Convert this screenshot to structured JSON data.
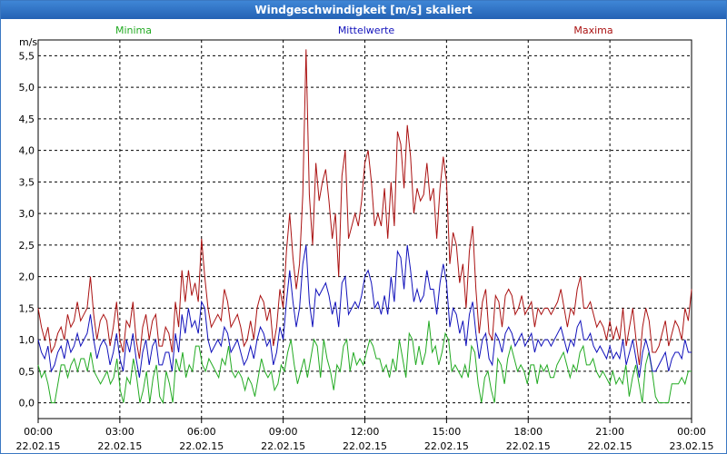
{
  "window": {
    "title": "Windgeschwindigkeit [m/s] skaliert"
  },
  "chart_data": {
    "type": "line",
    "ylabel": "m/s",
    "ylim": [
      -0.25,
      5.75
    ],
    "yticks": [
      0,
      0.5,
      1,
      1.5,
      2,
      2.5,
      3,
      3.5,
      4,
      4.5,
      5,
      5.5
    ],
    "ytick_labels": [
      "0,0",
      "0,5",
      "1,0",
      "1,5",
      "2,0",
      "2,5",
      "3,0",
      "3,5",
      "4,0",
      "4,5",
      "5,0",
      "5,5"
    ],
    "xlim": [
      0,
      24
    ],
    "xticks": [
      {
        "time": "00:00",
        "date": "22.02.15"
      },
      {
        "time": "03:00",
        "date": "22.02.15"
      },
      {
        "time": "06:00",
        "date": "22.02.15"
      },
      {
        "time": "09:00",
        "date": "22.02.15"
      },
      {
        "time": "12:00",
        "date": "22.02.15"
      },
      {
        "time": "15:00",
        "date": "22.02.15"
      },
      {
        "time": "18:00",
        "date": "22.02.15"
      },
      {
        "time": "21:00",
        "date": "22.02.15"
      },
      {
        "time": "00:00",
        "date": "23.02.15"
      }
    ],
    "grid": true,
    "legend_position": "top",
    "series": [
      {
        "name": "Minima",
        "color": "#22aa22",
        "values": [
          0.6,
          0.4,
          0.5,
          0.3,
          0.0,
          0.0,
          0.3,
          0.6,
          0.6,
          0.4,
          0.6,
          0.7,
          0.5,
          0.7,
          0.7,
          0.5,
          0.8,
          0.5,
          0.4,
          0.3,
          0.4,
          0.5,
          0.3,
          0.4,
          0.7,
          0.2,
          0.0,
          0.4,
          0.3,
          0.7,
          0.4,
          0.0,
          0.2,
          0.5,
          0.0,
          0.4,
          0.6,
          0.1,
          0.0,
          0.5,
          0.3,
          0.0,
          0.7,
          0.5,
          0.8,
          0.4,
          0.6,
          0.5,
          0.9,
          0.9,
          0.6,
          0.5,
          0.7,
          0.6,
          0.5,
          0.4,
          0.7,
          0.6,
          0.9,
          0.5,
          0.4,
          0.5,
          0.4,
          0.2,
          0.4,
          0.3,
          0.1,
          0.4,
          0.7,
          0.5,
          0.4,
          0.5,
          0.2,
          0.3,
          0.6,
          0.5,
          0.8,
          1.0,
          0.6,
          0.3,
          0.5,
          0.7,
          0.4,
          0.7,
          1.0,
          0.9,
          0.4,
          1.0,
          0.7,
          0.5,
          0.2,
          0.6,
          0.5,
          0.9,
          1.0,
          0.5,
          0.8,
          0.6,
          0.7,
          0.6,
          0.8,
          1.0,
          0.9,
          0.7,
          0.7,
          0.5,
          0.6,
          0.4,
          0.7,
          0.5,
          1.0,
          0.7,
          0.4,
          1.1,
          1.0,
          0.6,
          0.9,
          0.6,
          0.8,
          1.3,
          0.8,
          0.9,
          0.6,
          0.8,
          1.1,
          1.0,
          0.5,
          0.6,
          0.5,
          0.4,
          0.6,
          0.4,
          0.9,
          0.8,
          0.3,
          0.0,
          0.4,
          0.5,
          0.2,
          0.0,
          0.7,
          0.6,
          0.3,
          0.7,
          0.9,
          0.7,
          0.5,
          0.6,
          0.5,
          0.3,
          0.6,
          0.6,
          0.3,
          0.6,
          0.5,
          0.6,
          0.4,
          0.4,
          0.6,
          0.7,
          0.8,
          0.6,
          0.4,
          0.6,
          0.5,
          0.8,
          0.9,
          0.6,
          0.6,
          0.7,
          0.5,
          0.4,
          0.5,
          0.4,
          0.3,
          0.5,
          0.3,
          0.4,
          0.3,
          0.6,
          0.1,
          0.4,
          0.6,
          0.3,
          0.0,
          0.6,
          0.8,
          0.5,
          0.1,
          0.0,
          0.0,
          0.0,
          0.0,
          0.3,
          0.3,
          0.3,
          0.4,
          0.3,
          0.5,
          0.5
        ]
      },
      {
        "name": "Mittelwerte",
        "color": "#1111bb",
        "values": [
          1.0,
          0.8,
          0.7,
          0.9,
          0.5,
          0.6,
          0.8,
          0.9,
          0.7,
          1.0,
          0.8,
          0.9,
          1.1,
          0.9,
          1.0,
          1.1,
          1.4,
          1.0,
          0.7,
          0.9,
          1.0,
          0.9,
          0.6,
          0.8,
          1.1,
          0.7,
          0.5,
          1.0,
          0.8,
          1.1,
          0.7,
          0.4,
          0.8,
          1.0,
          0.6,
          0.9,
          1.0,
          0.6,
          0.6,
          0.8,
          0.8,
          0.5,
          1.1,
          0.8,
          1.4,
          1.1,
          1.5,
          1.2,
          1.3,
          1.1,
          1.6,
          1.5,
          1.0,
          0.8,
          0.9,
          1.0,
          0.9,
          1.2,
          1.1,
          0.8,
          0.9,
          1.0,
          0.8,
          0.6,
          0.7,
          0.9,
          0.7,
          1.0,
          1.2,
          1.1,
          0.9,
          1.0,
          0.6,
          0.8,
          1.2,
          1.0,
          1.6,
          2.1,
          1.6,
          1.2,
          1.5,
          2.2,
          2.5,
          1.6,
          1.2,
          1.8,
          1.7,
          1.8,
          1.9,
          1.7,
          1.4,
          1.6,
          1.2,
          1.9,
          2.0,
          1.4,
          1.5,
          1.6,
          1.5,
          1.7,
          2.0,
          2.1,
          1.9,
          1.5,
          1.6,
          1.4,
          1.7,
          1.4,
          2.0,
          1.6,
          2.4,
          2.3,
          1.8,
          2.5,
          2.1,
          1.6,
          1.8,
          1.6,
          1.7,
          2.1,
          1.8,
          1.8,
          1.4,
          1.9,
          2.2,
          1.9,
          1.2,
          1.5,
          1.4,
          1.1,
          1.3,
          0.9,
          1.4,
          1.6,
          1.1,
          0.7,
          1.0,
          1.1,
          0.7,
          0.6,
          1.1,
          1.0,
          0.8,
          1.1,
          1.2,
          1.1,
          0.9,
          1.0,
          1.1,
          0.9,
          1.0,
          1.1,
          0.8,
          1.0,
          0.9,
          1.0,
          1.0,
          0.9,
          1.0,
          1.1,
          1.2,
          1.0,
          0.8,
          1.0,
          0.9,
          1.2,
          1.3,
          1.0,
          1.0,
          1.1,
          0.9,
          0.8,
          0.9,
          0.8,
          0.7,
          0.9,
          0.7,
          0.8,
          0.7,
          1.0,
          0.6,
          0.8,
          1.0,
          0.7,
          0.4,
          0.8,
          1.0,
          0.8,
          0.5,
          0.5,
          0.6,
          0.7,
          0.8,
          0.5,
          0.7,
          0.8,
          0.8,
          0.7,
          1.0,
          0.8,
          0.8
        ]
      },
      {
        "name": "Maxima",
        "color": "#aa1111",
        "values": [
          1.5,
          1.2,
          1.0,
          1.2,
          0.8,
          0.9,
          1.1,
          1.2,
          1.0,
          1.4,
          1.2,
          1.3,
          1.6,
          1.3,
          1.4,
          1.5,
          2.0,
          1.4,
          1.0,
          1.3,
          1.4,
          1.3,
          0.9,
          1.2,
          1.6,
          1.0,
          0.8,
          1.3,
          1.2,
          1.6,
          1.0,
          0.7,
          1.2,
          1.4,
          1.0,
          1.3,
          1.4,
          0.9,
          0.9,
          1.2,
          1.1,
          0.8,
          1.6,
          1.2,
          2.1,
          1.6,
          2.1,
          1.7,
          1.9,
          1.6,
          2.6,
          2.0,
          1.5,
          1.2,
          1.3,
          1.4,
          1.3,
          1.8,
          1.6,
          1.2,
          1.3,
          1.4,
          1.2,
          0.9,
          1.0,
          1.3,
          1.0,
          1.5,
          1.7,
          1.6,
          1.3,
          1.5,
          0.9,
          1.2,
          1.8,
          1.5,
          2.4,
          3.0,
          2.3,
          1.8,
          2.2,
          3.3,
          5.6,
          3.3,
          2.5,
          3.8,
          3.2,
          3.5,
          3.7,
          3.2,
          2.6,
          3.0,
          2.0,
          3.6,
          4.0,
          2.6,
          2.8,
          3.0,
          2.8,
          3.2,
          3.8,
          4.0,
          3.5,
          2.8,
          3.0,
          2.8,
          3.4,
          2.6,
          3.5,
          2.8,
          4.3,
          4.1,
          3.4,
          4.4,
          3.9,
          3.0,
          3.4,
          3.2,
          3.3,
          3.8,
          3.2,
          3.4,
          2.6,
          3.4,
          3.9,
          3.5,
          2.2,
          2.7,
          2.5,
          1.9,
          2.2,
          1.5,
          2.4,
          2.8,
          1.8,
          1.1,
          1.6,
          1.8,
          1.1,
          1.0,
          1.7,
          1.6,
          1.2,
          1.7,
          1.8,
          1.7,
          1.4,
          1.5,
          1.7,
          1.4,
          1.5,
          1.6,
          1.2,
          1.5,
          1.4,
          1.5,
          1.5,
          1.4,
          1.5,
          1.6,
          1.8,
          1.5,
          1.2,
          1.5,
          1.4,
          1.8,
          2.0,
          1.5,
          1.5,
          1.6,
          1.4,
          1.2,
          1.3,
          1.2,
          1.0,
          1.3,
          1.0,
          1.2,
          1.0,
          1.5,
          0.9,
          1.2,
          1.5,
          1.0,
          0.6,
          1.2,
          1.5,
          1.3,
          0.8,
          0.8,
          0.9,
          1.1,
          1.3,
          0.9,
          1.1,
          1.3,
          1.2,
          1.0,
          1.5,
          1.3,
          1.8
        ]
      }
    ]
  }
}
